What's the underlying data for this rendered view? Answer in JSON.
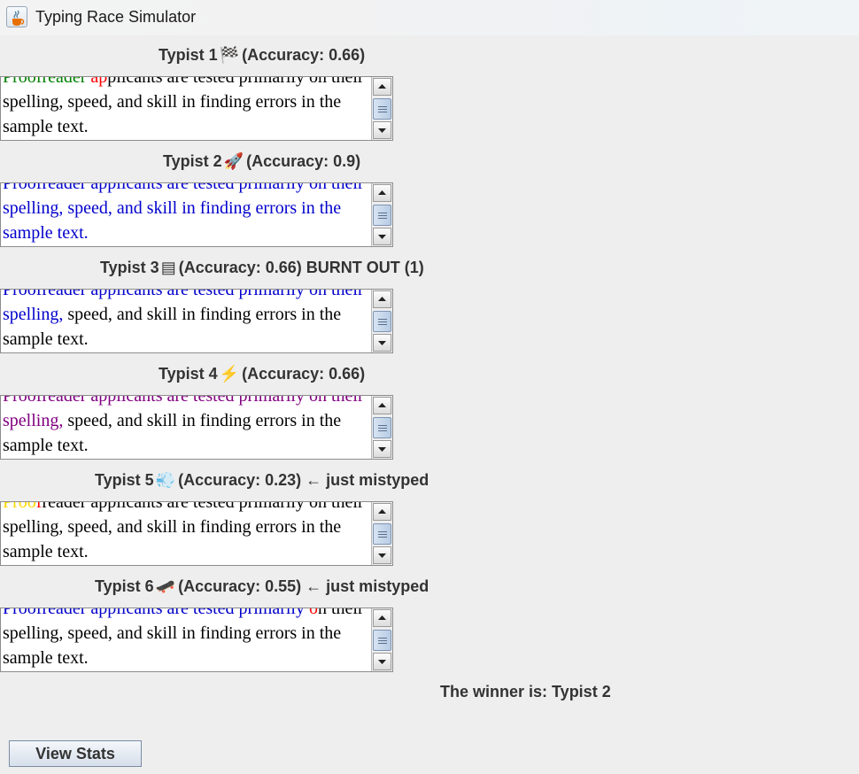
{
  "window": {
    "title": "Typing Race Simulator",
    "icon": "java-cup-icon"
  },
  "passage": {
    "line1": "Proofreader applicants are tested primarily on",
    "line2": "their spelling, speed, and skill in finding errors in",
    "line3": "the sample text."
  },
  "typists": [
    {
      "label_prefix": "Typist 1",
      "icon_glyph": "🏁",
      "icon_name": "checkered-flag-icon",
      "label_suffix": "(Accuracy: 0.66)",
      "segments": [
        {
          "text": "Proofreade",
          "color": "#008000"
        },
        {
          "text": "r ",
          "color": "#008000"
        },
        {
          "text": "ap",
          "color": "#ff0000"
        },
        {
          "text": "plicants are tested primarily on their spelling, speed, and skill in finding errors in the sample text.",
          "color": "#000000"
        }
      ]
    },
    {
      "label_prefix": "Typist 2",
      "icon_glyph": "🚀",
      "icon_name": "rocket-icon",
      "label_suffix": "(Accuracy: 0.9)",
      "segments": [
        {
          "text": "Proofreader applicants are tested primarily on their spelling, speed, and skill in finding errors in the sample text.",
          "color": "#0000cc"
        }
      ]
    },
    {
      "label_prefix": "Typist 3",
      "icon_glyph": "▤",
      "icon_name": "keyboard-icon",
      "label_suffix": "(Accuracy: 0.66) BURNT OUT (1)",
      "segments": [
        {
          "text": "Proofreader applicants are tested primarily on their spelling, ",
          "color": "#0000cc"
        },
        {
          "text": "speed, and skill in finding errors in the sample text.",
          "color": "#000000"
        }
      ]
    },
    {
      "label_prefix": "Typist 4",
      "icon_glyph": "⚡",
      "icon_name": "lightning-icon",
      "label_suffix": "(Accuracy: 0.66)",
      "segments": [
        {
          "text": "Proofreader applicants are tested primarily on their spelling, ",
          "color": "#800080"
        },
        {
          "text": "speed, and skill in finding errors in the sample text.",
          "color": "#000000"
        }
      ]
    },
    {
      "label_prefix": "Typist 5",
      "icon_glyph": "💨",
      "icon_name": "wind-icon",
      "label_suffix": "(Accuracy: 0.23) ← just mistyped",
      "segments": [
        {
          "text": "Proo",
          "color": "#ffd700"
        },
        {
          "text": "f",
          "color": "#ff0000"
        },
        {
          "text": "reader applicants are tested primarily on their spelling, speed, and skill in finding errors in the sample text.",
          "color": "#000000"
        }
      ]
    },
    {
      "label_prefix": "Typist 6",
      "icon_glyph": "🛹",
      "icon_name": "skateboard-icon",
      "label_suffix": "(Accuracy: 0.55) ← just mistyped",
      "segments": [
        {
          "text": "Proofreader applicants are tested primarily ",
          "color": "#0000cc"
        },
        {
          "text": "o",
          "color": "#ff0000"
        },
        {
          "text": "n their spelling, speed, and skill in finding errors in the sample text.",
          "color": "#000000"
        }
      ]
    }
  ],
  "winner_text": "The winner is:  Typist 2",
  "view_stats_label": "View Stats"
}
